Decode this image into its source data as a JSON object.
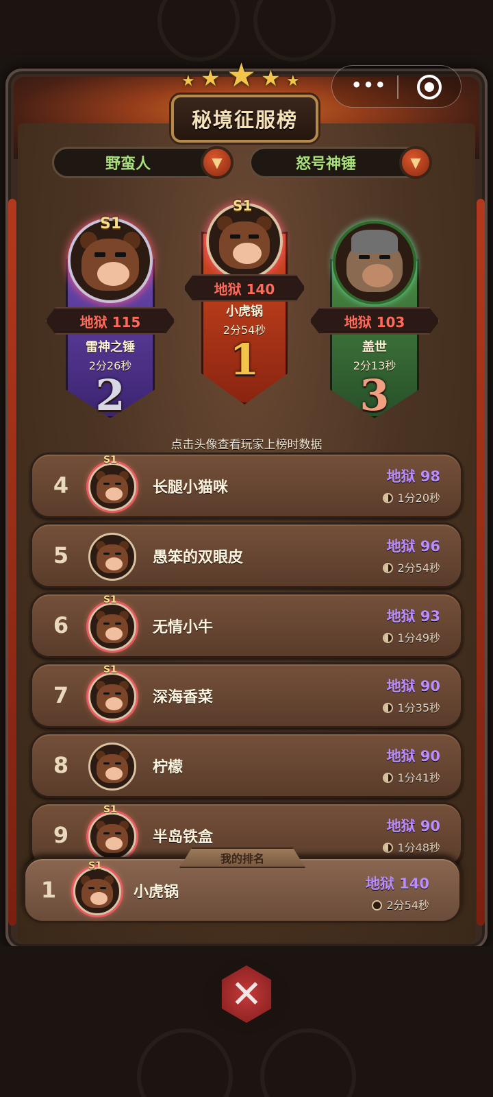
{
  "header": {
    "title": "秘境征服榜"
  },
  "capsule": {
    "more_icon": "more-dots-icon",
    "close_icon": "target-icon"
  },
  "selectors": {
    "class": "野蛮人",
    "weapon": "怒号神锤"
  },
  "podium": [
    {
      "rank": "1",
      "badge": "S1",
      "level": "地狱 140",
      "name": "小虎锅",
      "time": "2分54秒"
    },
    {
      "rank": "2",
      "badge": "S1",
      "level": "地狱 115",
      "name": "雷神之锤",
      "time": "2分26秒"
    },
    {
      "rank": "3",
      "badge": "",
      "level": "地狱 103",
      "name": "盖世",
      "time": "2分13秒"
    }
  ],
  "hint": "点击头像查看玩家上榜时数据",
  "list": [
    {
      "rank": "4",
      "badge": "S1",
      "name": "长腿小猫咪",
      "score": "地狱 98",
      "time": "1分20秒"
    },
    {
      "rank": "5",
      "badge": "",
      "name": "愚笨的双眼皮",
      "score": "地狱 96",
      "time": "2分54秒"
    },
    {
      "rank": "6",
      "badge": "S1",
      "name": "无情小牛",
      "score": "地狱 93",
      "time": "1分49秒"
    },
    {
      "rank": "7",
      "badge": "S1",
      "name": "深海香菜",
      "score": "地狱 90",
      "time": "1分35秒"
    },
    {
      "rank": "8",
      "badge": "",
      "name": "柠檬",
      "score": "地狱 90",
      "time": "1分41秒"
    },
    {
      "rank": "9",
      "badge": "S1",
      "name": "半岛铁盒",
      "score": "地狱 90",
      "time": "1分48秒"
    }
  ],
  "my_rank": {
    "tab_label": "我的排名",
    "rank": "1",
    "badge": "S1",
    "name": "小虎锅",
    "score": "地狱 140",
    "time": "2分54秒"
  },
  "colors": {
    "gold": "#f2c54a",
    "hell_red": "#ff6a5a",
    "hell_purple": "#b98cff",
    "rank1_banner": "#c6421c",
    "rank2_banner": "#5a3c9a",
    "rank3_banner": "#3f7a3a",
    "selector_text": "#a8e07a"
  }
}
